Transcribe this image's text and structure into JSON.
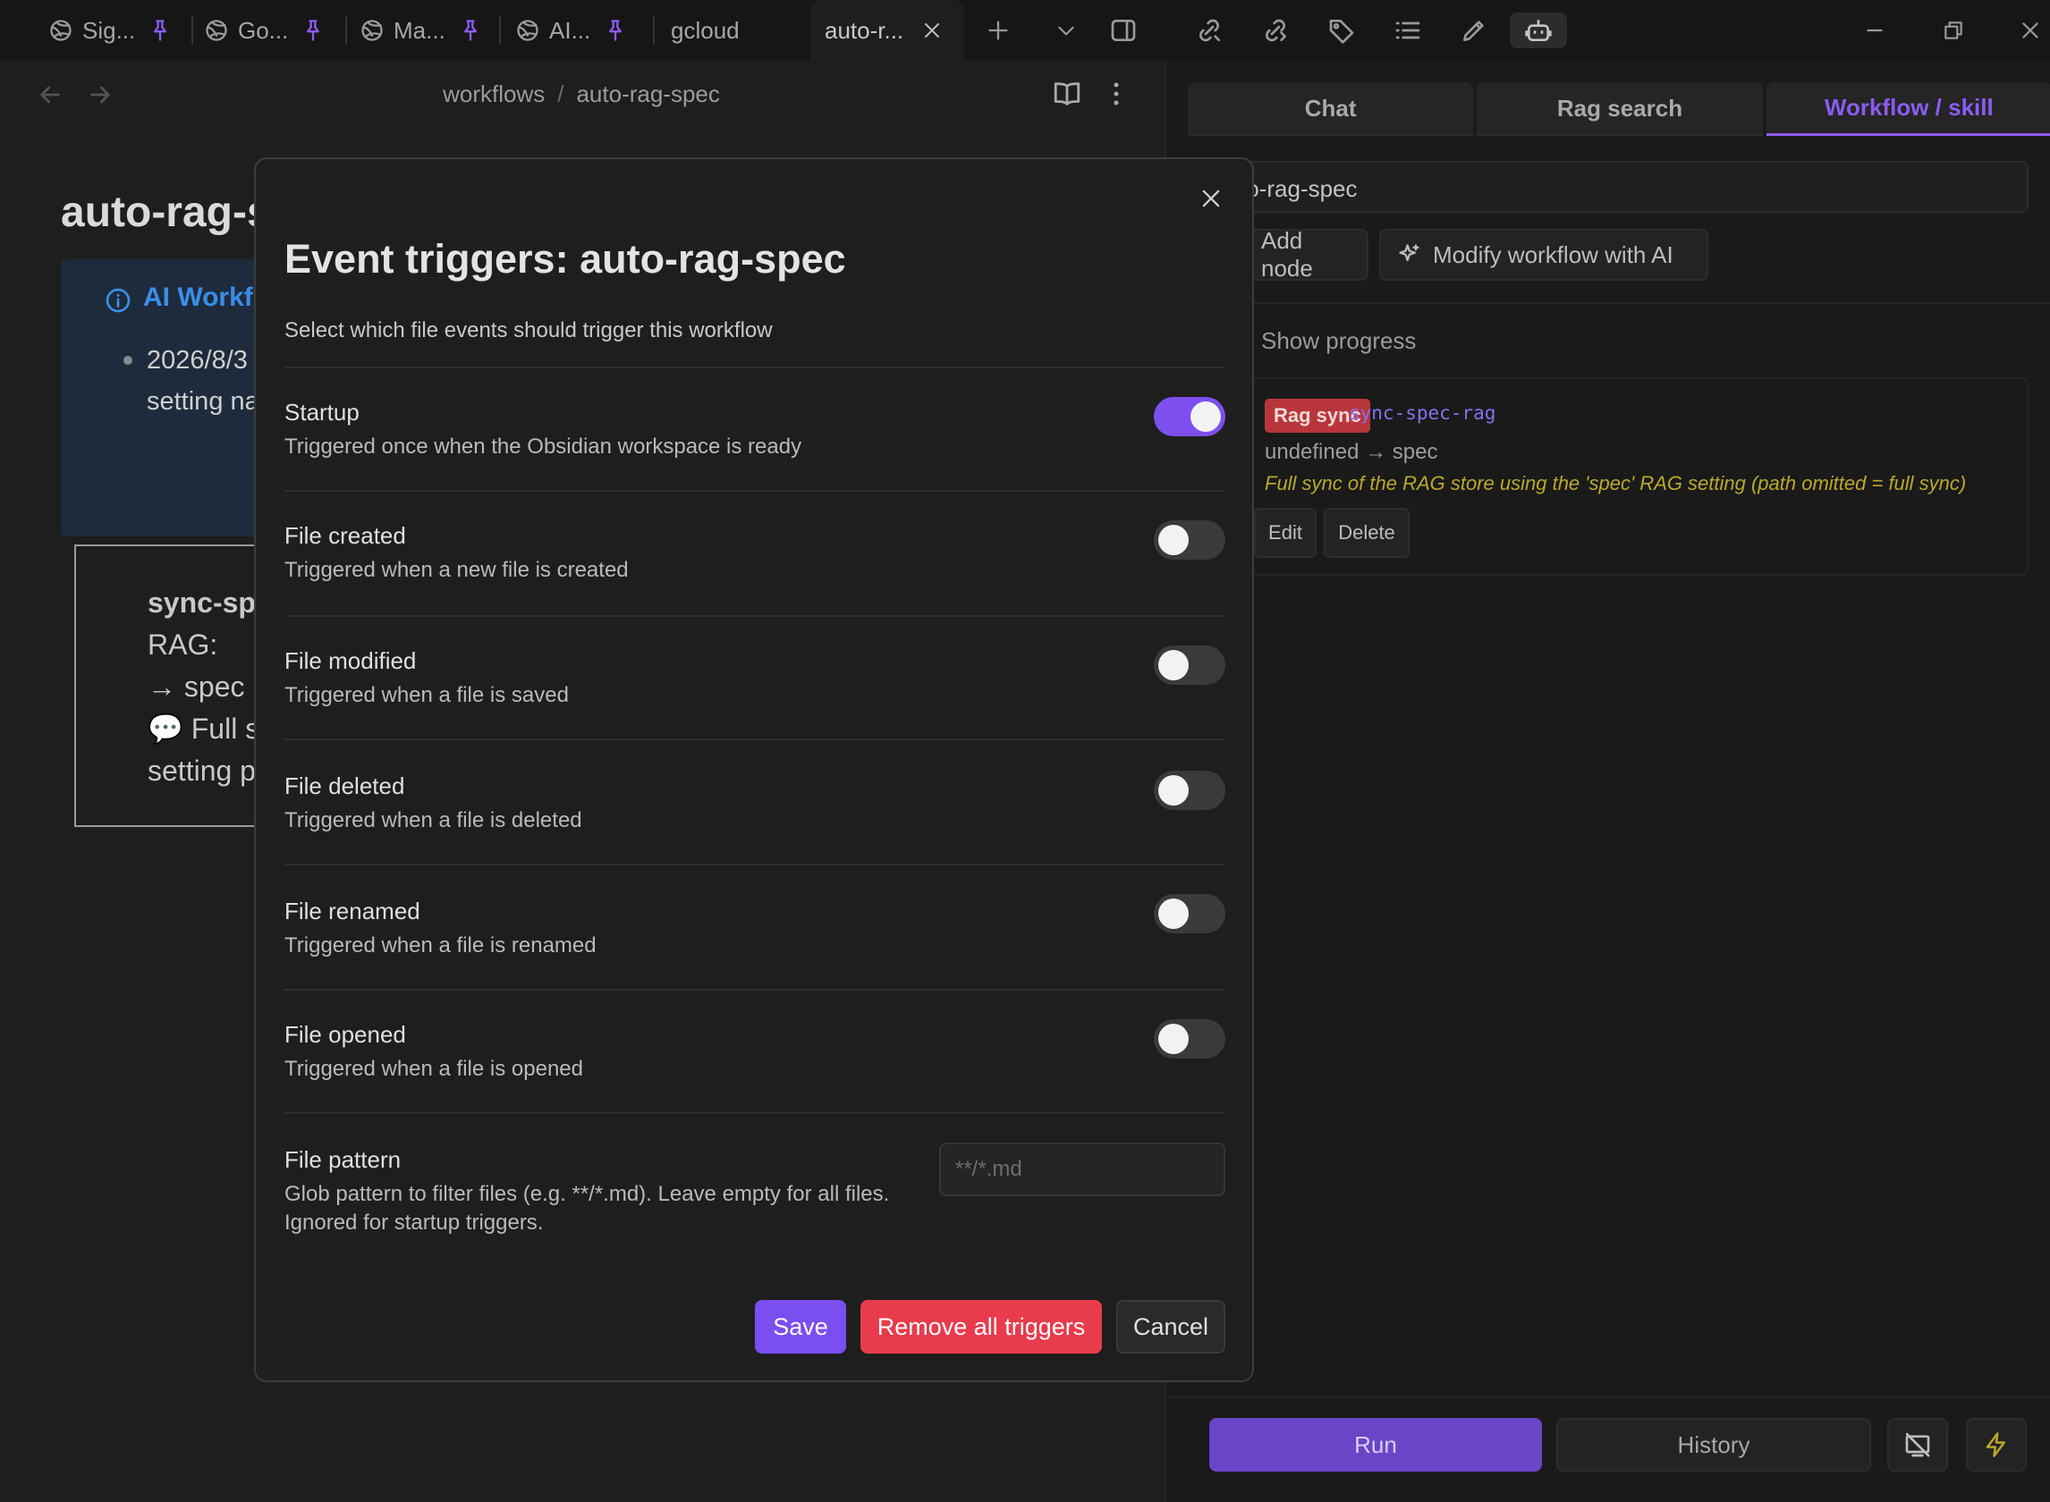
{
  "tabs": [
    {
      "label": "Sig...",
      "pinned": true
    },
    {
      "label": "Go...",
      "pinned": true
    },
    {
      "label": "Ma...",
      "pinned": true
    },
    {
      "label": "AI...",
      "pinned": true
    },
    {
      "label": "gcloud",
      "pinned": false
    },
    {
      "label": "auto-r...",
      "active": true
    }
  ],
  "editor": {
    "breadcrumb": [
      "workflows",
      "auto-rag-spec"
    ],
    "title_visible": "auto-rag-s",
    "callout_title": "AI Workf",
    "callout_lines": [
      "2026/8/3",
      "setting na"
    ],
    "code_lines": [
      "sync-spe",
      "RAG:",
      "→ spec",
      "💬 Full s",
      "setting p"
    ]
  },
  "panel": {
    "tabs": [
      "Chat",
      "Rag search",
      "Workflow / skill"
    ],
    "active_tab": "Workflow / skill",
    "workflow_name": "to-rag-spec",
    "add_node": "Add node",
    "modify_ai": "Modify workflow with AI",
    "show_progress": "Show progress",
    "node": {
      "type": "Rag sync",
      "id": "sync-spec-rag",
      "io": "undefined → spec",
      "description": "Full sync of the RAG store using the 'spec' RAG setting (path omitted = full sync)",
      "edit": "Edit",
      "delete": "Delete"
    },
    "run": "Run",
    "history": "History"
  },
  "modal": {
    "title": "Event triggers: auto-rag-spec",
    "subtitle": "Select which file events should trigger this workflow",
    "triggers": [
      {
        "name": "Startup",
        "desc": "Triggered once when the Obsidian workspace is ready",
        "enabled": true
      },
      {
        "name": "File created",
        "desc": "Triggered when a new file is created",
        "enabled": false
      },
      {
        "name": "File modified",
        "desc": "Triggered when a file is saved",
        "enabled": false
      },
      {
        "name": "File deleted",
        "desc": "Triggered when a file is deleted",
        "enabled": false
      },
      {
        "name": "File renamed",
        "desc": "Triggered when a file is renamed",
        "enabled": false
      },
      {
        "name": "File opened",
        "desc": "Triggered when a file is opened",
        "enabled": false
      }
    ],
    "pattern": {
      "label": "File pattern",
      "desc_line1": "Glob pattern to filter files (e.g. **/*.md). Leave empty for all files.",
      "desc_line2": "Ignored for startup triggers.",
      "placeholder": "**/*.md",
      "value": ""
    },
    "save": "Save",
    "remove_all": "Remove all triggers",
    "cancel": "Cancel"
  },
  "colors": {
    "accent": "#7b4ef0",
    "danger": "#e83b4c",
    "node_badge": "#b8363b",
    "link_blue": "#3b8ee6"
  }
}
